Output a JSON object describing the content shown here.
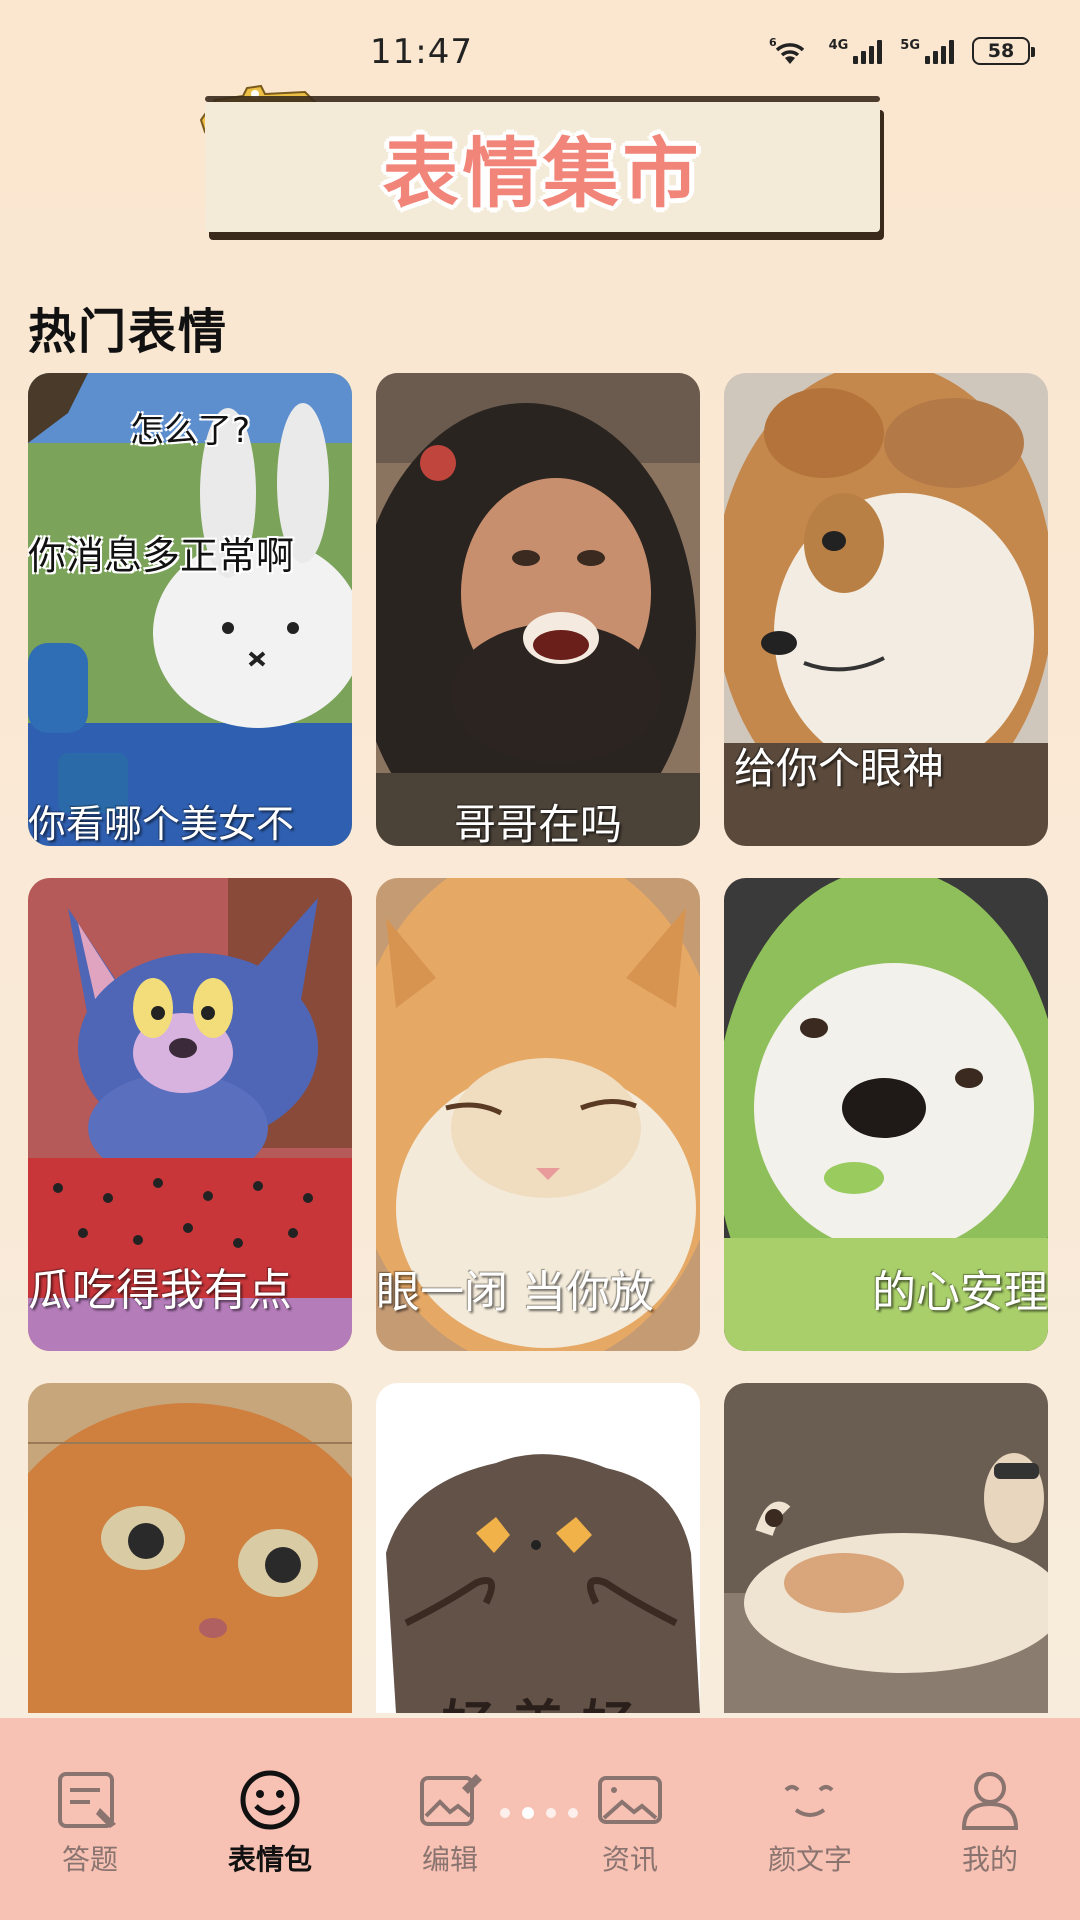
{
  "status_bar": {
    "time": "11:47",
    "battery": "58",
    "net1": "4G",
    "net2": "5G",
    "wifi_badge": "6"
  },
  "banner": {
    "title": "表情集市"
  },
  "section": {
    "title": "热门表情"
  },
  "cards": [
    {
      "name": "miffy",
      "captions": [
        "怎么了?",
        "你消息多正常啊",
        "你看哪个美女不"
      ]
    },
    {
      "name": "long-hair-man",
      "captions": [
        "哥哥在吗"
      ]
    },
    {
      "name": "shiba-puppy",
      "captions": [
        "给你个眼神"
      ]
    },
    {
      "name": "tom-cat",
      "captions": [
        "瓜吃得我有点"
      ]
    },
    {
      "name": "orange-cat",
      "captions": [
        "眼一闭 当你放"
      ]
    },
    {
      "name": "cabbage-dog",
      "captions": [
        "的心安理"
      ]
    },
    {
      "name": "cat-closeup",
      "captions": []
    },
    {
      "name": "brown-blob",
      "captions": [
        "好 美 好"
      ]
    },
    {
      "name": "lying-dog",
      "captions": []
    }
  ],
  "tabs": [
    {
      "label": "答题",
      "icon": "quiz-icon"
    },
    {
      "label": "表情包",
      "icon": "smiley-icon",
      "active": true
    },
    {
      "label": "编辑",
      "icon": "edit-image-icon"
    },
    {
      "label": "资讯",
      "icon": "news-image-icon"
    },
    {
      "label": "颜文字",
      "icon": "kaomoji-face-icon"
    },
    {
      "label": "我的",
      "icon": "profile-icon"
    }
  ]
}
